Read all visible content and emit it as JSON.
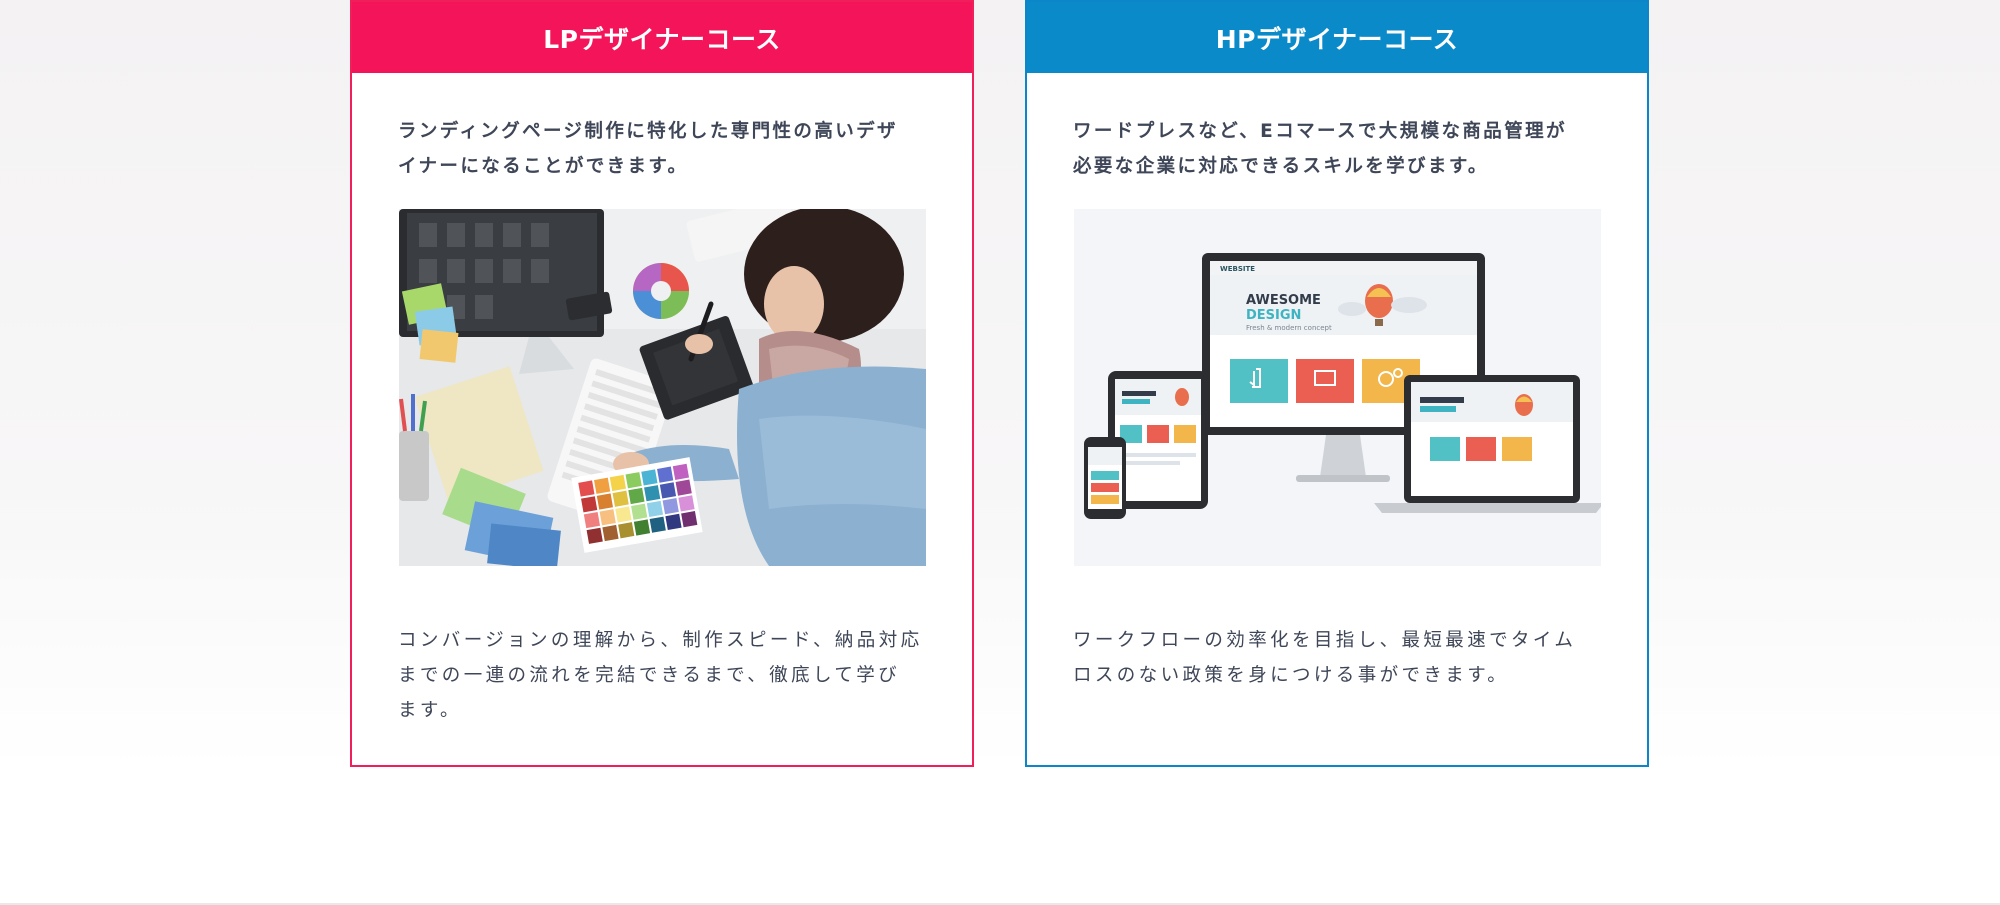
{
  "courses": [
    {
      "title": "LPデザイナーコース",
      "intro_line1": "ランディングページ制作に特化した専門性の高いデザ",
      "intro_line2": "イナーになることができます。",
      "outro_line1": "コンバージョンの理解から、制作スピード、納品対応",
      "outro_line2": "までの一連の流れを完結できるまで、徹底して学び",
      "outro_line3": "ます。",
      "color": "#f41459"
    },
    {
      "title": "HPデザイナーコース",
      "intro_line1": "ワードプレスなど、Eコマースで大規模な商品管理が",
      "intro_line2": "必要な企業に対応できるスキルを学びます。",
      "outro_line1": "ワークフローの効率化を目指し、最短最速でタイム",
      "outro_line2": "ロスのない政策を身につける事ができます。",
      "color": "#0b8ac9"
    }
  ],
  "mockup": {
    "website_label": "WEBSITE",
    "headline_1": "AWESOME",
    "headline_2": "DESIGN",
    "tagline": "Fresh & modern concept"
  }
}
